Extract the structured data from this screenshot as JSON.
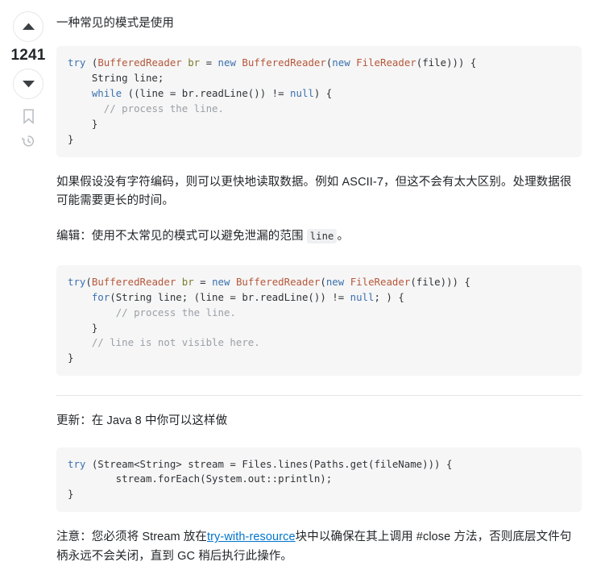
{
  "vote": {
    "upvote_label": "Up vote",
    "score": "1241",
    "downvote_label": "Down vote",
    "bookmark_label": "Save this answer",
    "history_label": "Show activity on this post"
  },
  "post": {
    "intro": "一种常见的模式是使用",
    "code1": {
      "lines": [
        [
          [
            "try",
            "tok-kw"
          ],
          [
            " (",
            "tok-pl"
          ],
          [
            "BufferedReader",
            "tok-type"
          ],
          [
            " ",
            "tok-pl"
          ],
          [
            "br",
            "tok-var"
          ],
          [
            " = ",
            "tok-pl"
          ],
          [
            "new",
            "tok-kw"
          ],
          [
            " ",
            "tok-pl"
          ],
          [
            "BufferedReader",
            "tok-type"
          ],
          [
            "(",
            "tok-pl"
          ],
          [
            "new",
            "tok-kw"
          ],
          [
            " ",
            "tok-pl"
          ],
          [
            "FileReader",
            "tok-type"
          ],
          [
            "(file))) {",
            "tok-pl"
          ]
        ],
        [
          [
            "    String line;",
            "tok-pl"
          ]
        ],
        [
          [
            "    ",
            "tok-pl"
          ],
          [
            "while",
            "tok-kw"
          ],
          [
            " ((line = br.readLine()) != ",
            "tok-pl"
          ],
          [
            "null",
            "tok-kw"
          ],
          [
            ") {",
            "tok-pl"
          ]
        ],
        [
          [
            "      ",
            "tok-pl"
          ],
          [
            "// process the line.",
            "tok-cmt"
          ]
        ],
        [
          [
            "    }",
            "tok-pl"
          ]
        ],
        [
          [
            "}",
            "tok-pl"
          ]
        ]
      ]
    },
    "para2": "如果假设没有字符编码，则可以更快地读取数据。例如 ASCII-7，但这不会有太大区别。处理数据很可能需要更长的时间。",
    "para3_prefix": "编辑：使用不太常见的模式可以避免泄漏的范围 ",
    "para3_code": "line",
    "para3_suffix": "。",
    "code2": {
      "lines": [
        [
          [
            "try",
            "tok-kw"
          ],
          [
            "(",
            "tok-pl"
          ],
          [
            "BufferedReader",
            "tok-type"
          ],
          [
            " ",
            "tok-pl"
          ],
          [
            "br",
            "tok-var"
          ],
          [
            " = ",
            "tok-pl"
          ],
          [
            "new",
            "tok-kw"
          ],
          [
            " ",
            "tok-pl"
          ],
          [
            "BufferedReader",
            "tok-type"
          ],
          [
            "(",
            "tok-pl"
          ],
          [
            "new",
            "tok-kw"
          ],
          [
            " ",
            "tok-pl"
          ],
          [
            "FileReader",
            "tok-type"
          ],
          [
            "(file))) {",
            "tok-pl"
          ]
        ],
        [
          [
            "    ",
            "tok-pl"
          ],
          [
            "for",
            "tok-kw"
          ],
          [
            "(String line; (line = br.readLine()) != ",
            "tok-pl"
          ],
          [
            "null",
            "tok-kw"
          ],
          [
            "; ) {",
            "tok-pl"
          ]
        ],
        [
          [
            "        ",
            "tok-pl"
          ],
          [
            "// process the line.",
            "tok-cmt"
          ]
        ],
        [
          [
            "    }",
            "tok-pl"
          ]
        ],
        [
          [
            "    ",
            "tok-pl"
          ],
          [
            "// line is not visible here.",
            "tok-cmt"
          ]
        ],
        [
          [
            "}",
            "tok-pl"
          ]
        ]
      ]
    },
    "para4": "更新：在 Java 8 中你可以这样做",
    "code3": {
      "lines": [
        [
          [
            "try",
            "tok-kw"
          ],
          [
            " (Stream<String> stream = Files.lines(Paths.get(fileName))) {",
            "tok-pl"
          ]
        ],
        [
          [
            "        stream.forEach(System.out::println);",
            "tok-pl"
          ]
        ],
        [
          [
            "}",
            "tok-pl"
          ]
        ]
      ]
    },
    "para5_prefix": "注意：您必须将 Stream 放在",
    "para5_link": "try-with-resource",
    "para5_suffix": "块中以确保在其上调用 #close 方法，否则底层文件句柄永远不会关闭，直到 GC 稍后执行此操作。"
  }
}
